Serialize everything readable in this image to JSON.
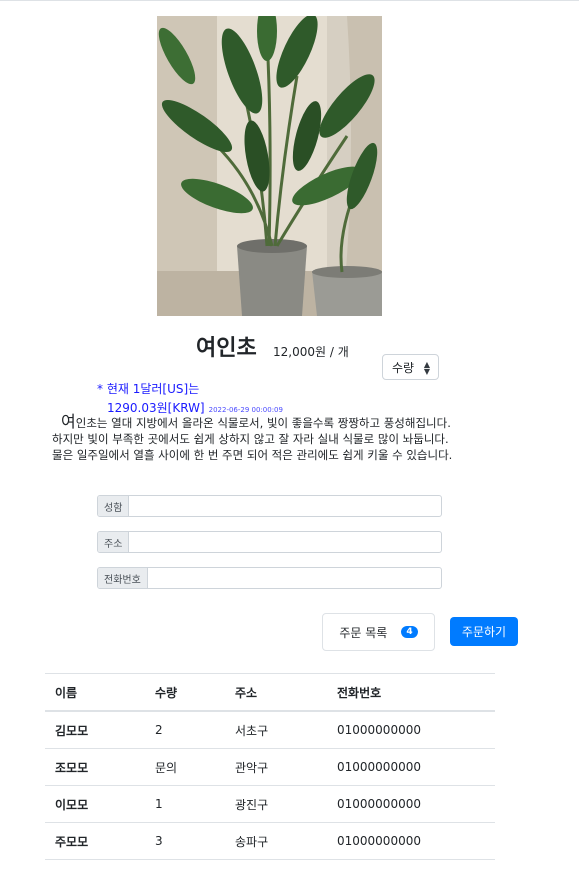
{
  "product": {
    "name": "여인초",
    "price": "12,000원 / 개",
    "quantity_select": "수량"
  },
  "exchange": {
    "line1": "* 현재 1달러[US]는",
    "rate": "1290.03원[KRW]",
    "date": "2022-06-29 00:00:09"
  },
  "description": {
    "first_char": "여",
    "line1_rest": "인초는 열대 지방에서 올라온 식물로서, 빛이 좋을수록 짱짱하고 풍성해집니다.",
    "line2": "하지만 빛이 부족한 곳에서도 쉽게 상하지 않고 잘 자라 실내 식물로 많이 놔둡니다.",
    "line3": "물은 일주일에서 열흘 사이에 한 번 주면 되어 적은 관리에도 쉽게 키울 수 있습니다."
  },
  "form": {
    "name_label": "성함",
    "address_label": "주소",
    "phone_label": "전화번호",
    "name_value": "",
    "address_value": "",
    "phone_value": ""
  },
  "actions": {
    "order_list_label": "주문 목록",
    "order_count": "4",
    "order_button": "주문하기"
  },
  "table": {
    "headers": [
      "이름",
      "수량",
      "주소",
      "전화번호"
    ],
    "rows": [
      [
        "김모모",
        "2",
        "서초구",
        "01000000000"
      ],
      [
        "조모모",
        "문의",
        "관악구",
        "01000000000"
      ],
      [
        "이모모",
        "1",
        "광진구",
        "01000000000"
      ],
      [
        "주모모",
        "3",
        "송파구",
        "01000000000"
      ]
    ]
  }
}
